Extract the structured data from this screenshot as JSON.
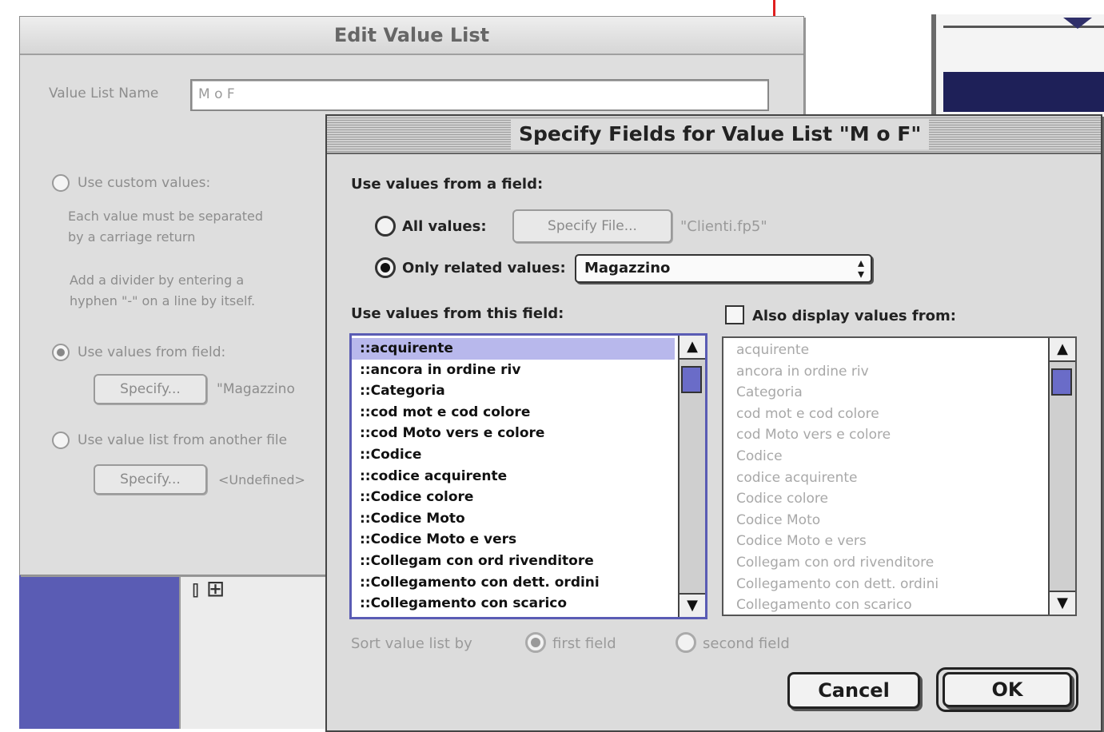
{
  "edit_value_list": {
    "title": "Edit Value List",
    "name_label": "Value List Name",
    "name_value": "M o F",
    "options": {
      "custom_label": "Use custom values:",
      "custom_help_1": "Each value must be separated",
      "custom_help_2": "by a carriage return",
      "custom_help_3": "Add a divider by entering a",
      "custom_help_4": "hyphen \"-\" on a line by itself.",
      "field_label": "Use values from field:",
      "field_specify": "Specify...",
      "field_value": "\"Magazzino",
      "other_file_label": "Use value list from another file",
      "other_specify": "Specify...",
      "other_value": "<Undefined>"
    }
  },
  "specify_fields": {
    "title": "Specify Fields for Value List \"M o F\"",
    "use_values_from_field": "Use values from a field:",
    "all_values_label": "All values:",
    "specify_file_button": "Specify File...",
    "file_name": "\"Clienti.fp5\"",
    "only_related_label": "Only related values:",
    "relationship": "Magazzino",
    "this_field_label": "Use values from this field:",
    "also_display_label": "Also display values from:",
    "fields": [
      "::acquirente",
      "::ancora in ordine riv",
      "::Categoria",
      "::cod mot e cod colore",
      "::cod Moto vers e colore",
      "::Codice",
      "::codice acquirente",
      "::Codice colore",
      "::Codice Moto",
      "::Codice Moto e vers",
      "::Collegam con ord rivenditore",
      "::Collegamento con dett. ordini",
      "::Collegamento con scarico"
    ],
    "fields_dim": [
      "acquirente",
      "ancora in ordine riv",
      "Categoria",
      "cod mot e cod colore",
      "cod Moto vers e colore",
      "Codice",
      "codice acquirente",
      "Codice colore",
      "Codice Moto",
      "Codice Moto e vers",
      "Collegam con ord rivenditore",
      "Collegamento con dett. ordini",
      "Collegamento con scarico"
    ],
    "sort_label": "Sort value list by",
    "sort_first": "first field",
    "sort_second": "second field",
    "cancel": "Cancel",
    "ok": "OK"
  }
}
